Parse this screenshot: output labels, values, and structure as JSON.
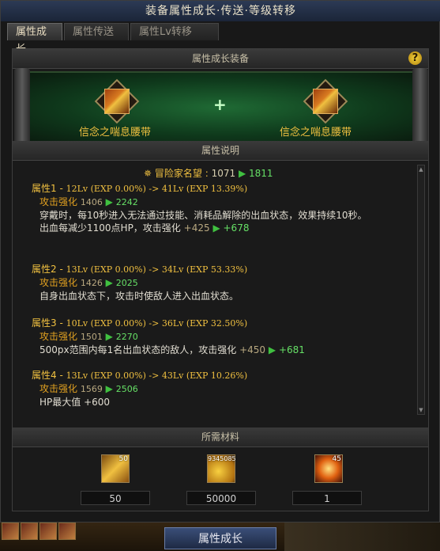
{
  "window": {
    "title": "装备属性成长·传送·等级转移"
  },
  "tabs": [
    {
      "label": "属性成长",
      "active": true
    },
    {
      "label": "属性传送",
      "active": false
    },
    {
      "label": "属性Lv转移",
      "active": false
    }
  ],
  "sections": {
    "equip": "属性成长装备",
    "description": "属性说明",
    "materials": "所需材料"
  },
  "help_icon": "?",
  "equip": {
    "source": {
      "name": "信念之喘息腰带",
      "icon": "belt-icon"
    },
    "target": {
      "name": "信念之喘息腰带",
      "icon": "belt-icon"
    },
    "plus": "+"
  },
  "fame": {
    "label": "冒险家名望 : ",
    "old": "1071",
    "arrow": "▶",
    "new": "1811"
  },
  "attributes": [
    {
      "header": "属性1 - ",
      "level": "12Lv (EXP 0.00%) -> 41Lv (EXP 13.39%)",
      "stat_label": "攻击强化",
      "stat_old": "1406",
      "stat_new": "2242",
      "desc1": "穿戴时，每10秒进入无法通过技能、消耗品解除的出血状态，效果持续10秒。",
      "desc2_text": "出血每减少1100点HP，攻击强化",
      "desc2_old": "+425",
      "desc2_new": "+678"
    },
    {
      "header": "属性2 - ",
      "level": "13Lv (EXP 0.00%) -> 34Lv (EXP 53.33%)",
      "stat_label": "攻击强化",
      "stat_old": "1426",
      "stat_new": "2025",
      "desc1": "自身出血状态下，攻击时使敌人进入出血状态。"
    },
    {
      "header": "属性3 - ",
      "level": "10Lv (EXP 0.00%) -> 36Lv (EXP 32.50%)",
      "stat_label": "攻击强化",
      "stat_old": "1501",
      "stat_new": "2270",
      "desc2_text": "500px范围内每1名出血状态的敌人，攻击强化",
      "desc2_old": "+450",
      "desc2_new": "+681"
    },
    {
      "header": "属性4 - ",
      "level": "13Lv (EXP 0.00%) -> 43Lv (EXP 10.26%)",
      "stat_label": "攻击强化",
      "stat_old": "1569",
      "stat_new": "2506",
      "desc1": "HP最大值 +600"
    }
  ],
  "materials": [
    {
      "icon": "gold-card-icon",
      "badge": "50",
      "qty": "50"
    },
    {
      "icon": "gold-coins-icon",
      "badge": "9345085",
      "qty": "50000"
    },
    {
      "icon": "explosion-orb-icon",
      "badge": "45",
      "qty": "1"
    }
  ],
  "action_button": "属性成长",
  "colors": {
    "accent_gold": "#f0c040",
    "increase_green": "#66e066",
    "bar_green": "#1f6a34"
  }
}
